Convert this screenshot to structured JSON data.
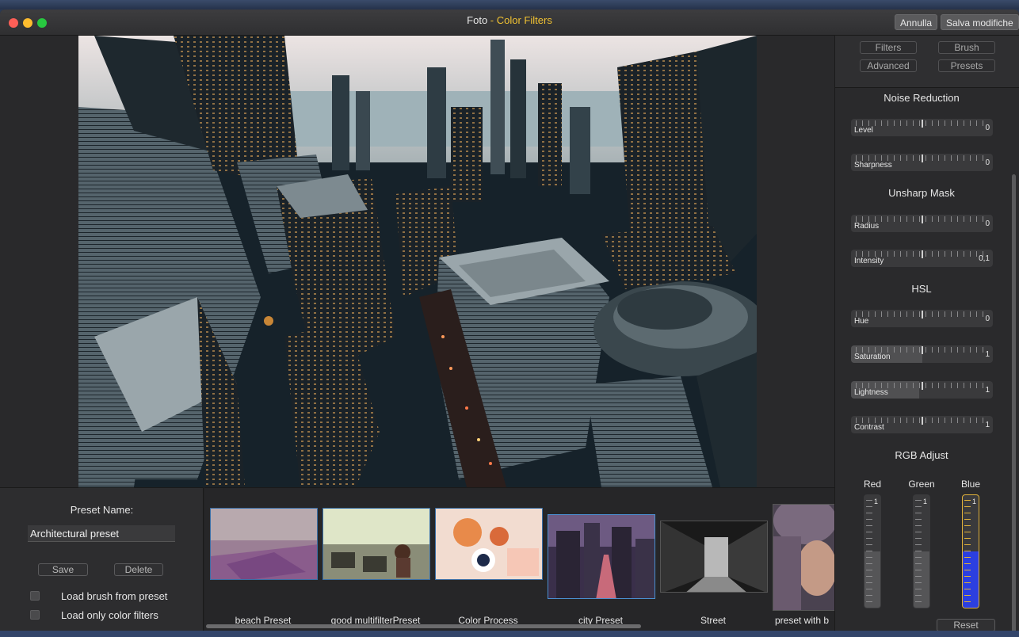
{
  "window": {
    "app_name": "Foto",
    "separator": " - ",
    "section_name": "Color Filters",
    "accent_color": "#f1c232",
    "cancel_label": "Annulla",
    "save_changes_label": "Salva modifiche"
  },
  "preset": {
    "name_label": "Preset Name:",
    "name_value": "Architectural preset",
    "save_label": "Save",
    "delete_label": "Delete",
    "load_brush_label": "Load brush from preset",
    "load_brush_checked": false,
    "load_color_label": "Load only color filters",
    "load_color_checked": false
  },
  "thumbnails": [
    {
      "label": "beach Preset",
      "selected": false
    },
    {
      "label": "good multifilterPreset",
      "selected": false
    },
    {
      "label": "Color Process",
      "selected": false
    },
    {
      "label": "city Preset",
      "selected": true
    },
    {
      "label": "Street",
      "selected": false
    },
    {
      "label": "preset with b",
      "selected": false
    }
  ],
  "tabs": {
    "filters": "Filters",
    "brush": "Brush",
    "advanced": "Advanced",
    "presets": "Presets"
  },
  "sections": {
    "noise_reduction": {
      "title": "Noise Reduction",
      "level": {
        "name": "Level",
        "value": "0"
      },
      "sharpness": {
        "name": "Sharpness",
        "value": "0"
      }
    },
    "unsharp_mask": {
      "title": "Unsharp Mask",
      "radius": {
        "name": "Radius",
        "value": "0"
      },
      "intensity": {
        "name": "Intensity",
        "value": "0,1"
      }
    },
    "hsl": {
      "title": "HSL",
      "hue": {
        "name": "Hue",
        "value": "0"
      },
      "saturation": {
        "name": "Saturation",
        "value": "1",
        "fill_fraction": 0.5
      },
      "lightness": {
        "name": "Lightness",
        "value": "1",
        "fill_fraction": 0.48
      },
      "contrast": {
        "name": "Contrast",
        "value": "1",
        "fill_fraction": 0.0
      }
    },
    "rgb": {
      "title": "RGB Adjust",
      "red": {
        "name": "Red",
        "value": "1",
        "fill_fraction": 0.5
      },
      "green": {
        "name": "Green",
        "value": "1",
        "fill_fraction": 0.5
      },
      "blue": {
        "name": "Blue",
        "value": "1",
        "fill_fraction": 0.5,
        "color": "#2c3fe0"
      }
    },
    "reset_label": "Reset"
  }
}
